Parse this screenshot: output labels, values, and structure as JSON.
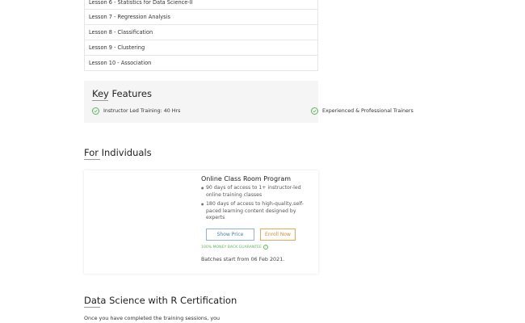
{
  "course": {
    "lessons": [
      "Lesson 6 - Statistics for Data Science-II",
      "Lesson 7 - Regression Analysis",
      "Lesson 8 - Classification",
      "Lesson 9 - Clustering",
      "Lesson 10 - Association"
    ]
  },
  "key_features": {
    "title": "Key Features",
    "items": [
      "Instructor Led Training: 40 Hrs",
      "Experienced & Professional Trainers"
    ]
  },
  "for_individuals": {
    "title": "For Individuals",
    "program": {
      "title": "Online Class Room Program",
      "bullets": [
        "90 days of access to 1+ instructor-led online training classes",
        "180 days of access to high-quality,self-paced learning content designed by experts"
      ],
      "show_price_label": "Show Price",
      "enroll_label": "Enroll Now",
      "guarantee_text": "100% MONEY BACK GUARANTEE",
      "guarantee_icon": "question-icon",
      "batches_text": "Batches start from 06 Feb 2021."
    }
  },
  "certification": {
    "title": "Data Science with R Certification",
    "description": "Once you have completed the training sessions, you"
  },
  "colors": {
    "check": "#5cb85c",
    "price_button": "#4a7db3",
    "enroll_button": "#e08a2e",
    "features_bg": "#f5f5f5"
  }
}
